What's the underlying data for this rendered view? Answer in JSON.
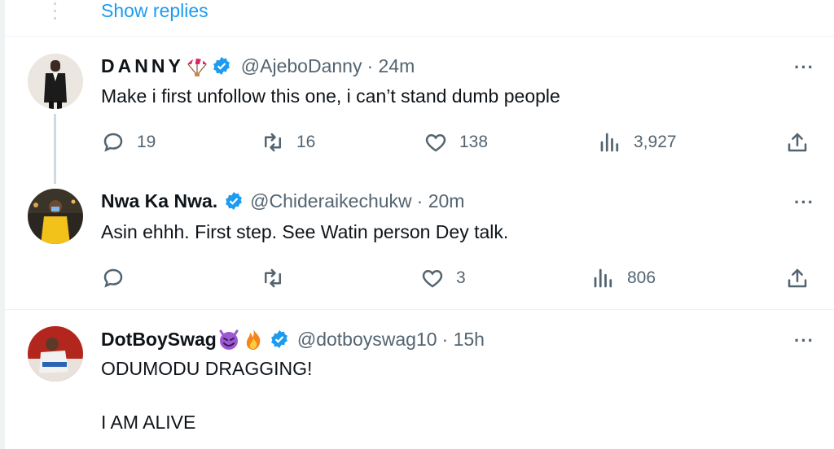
{
  "show_replies": "Show replies",
  "tweets": [
    {
      "name": "DANNY",
      "handle": "@AjeboDanny",
      "time": "· 24m",
      "text": "Make i first unfollow this one, i can’t stand dumb people",
      "replies": "19",
      "retweets": "16",
      "likes": "138",
      "views": "3,927"
    },
    {
      "name": "Nwa Ka Nwa.",
      "handle": "@Chideraikechukw",
      "time": "· 20m",
      "text": "Asin ehhh. First step. See Watin person Dey talk.",
      "replies": "",
      "retweets": "",
      "likes": "3",
      "views": "806"
    },
    {
      "name": "DotBoySwag",
      "handle": "@dotboyswag10",
      "time": "· 15h",
      "text": "ODUMODU DRAGGING!\n\nI AM ALIVE"
    }
  ],
  "more_label": "···",
  "colors": {
    "accent": "#1d9bf0",
    "muted": "#536471",
    "text": "#0f1419"
  }
}
